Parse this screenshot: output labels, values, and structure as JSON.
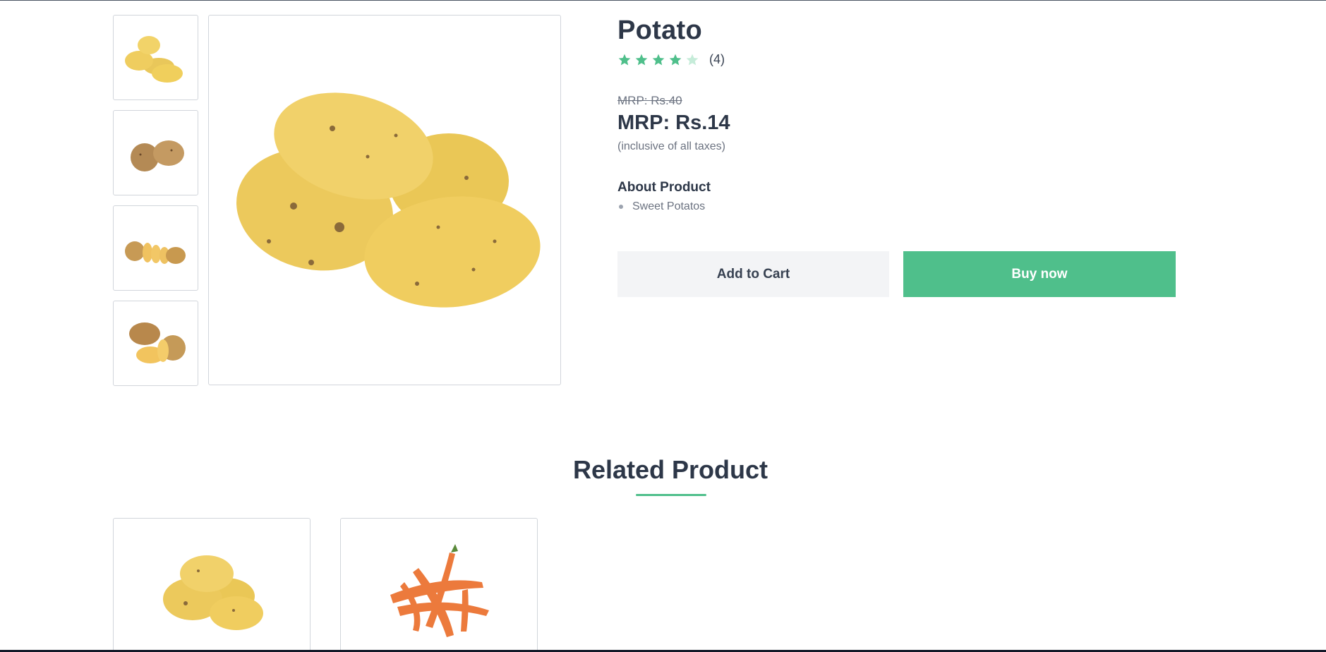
{
  "product": {
    "name": "Potato",
    "rating": 4,
    "rating_max": 5,
    "rating_count": "(4)",
    "old_price": "MRP: Rs.40",
    "price": "MRP: Rs.14",
    "tax_note": "(inclusive of all taxes)",
    "about_heading": "About Product",
    "about_items": [
      "Sweet Potatos"
    ]
  },
  "actions": {
    "add_to_cart": "Add to Cart",
    "buy_now": "Buy now"
  },
  "related": {
    "heading": "Related Product",
    "products": [
      {
        "image": "potato"
      },
      {
        "image": "carrot"
      }
    ]
  },
  "colors": {
    "accent": "#4fbf8b",
    "star_empty": "#c6ecd9",
    "text_dark": "#2d3748",
    "muted": "#6b7280"
  }
}
